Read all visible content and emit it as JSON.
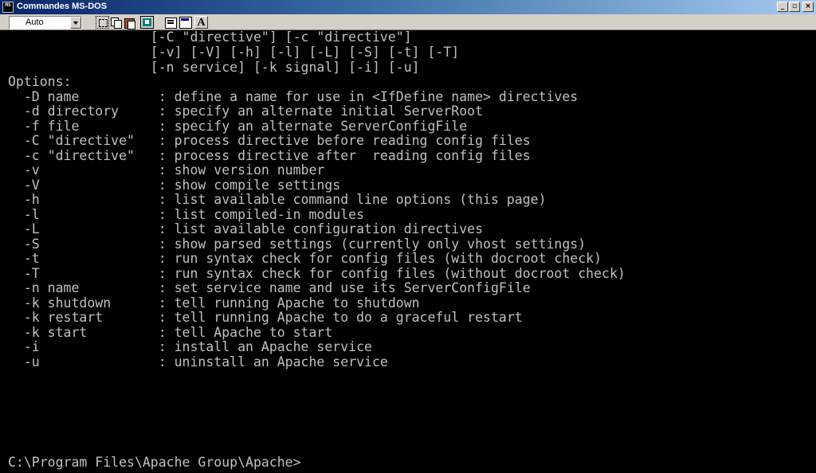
{
  "window": {
    "title": "Commandes MS-DOS",
    "icon_text": "MS"
  },
  "toolbar": {
    "font_size": "Auto",
    "font_button_label": "A"
  },
  "console": {
    "lines": [
      "                  [-C \"directive\"] [-c \"directive\"]",
      "                  [-v] [-V] [-h] [-l] [-L] [-S] [-t] [-T]",
      "                  [-n service] [-k signal] [-i] [-u]",
      "Options:",
      "  -D name          : define a name for use in <IfDefine name> directives",
      "  -d directory     : specify an alternate initial ServerRoot",
      "  -f file          : specify an alternate ServerConfigFile",
      "  -C \"directive\"   : process directive before reading config files",
      "  -c \"directive\"   : process directive after  reading config files",
      "  -v               : show version number",
      "  -V               : show compile settings",
      "  -h               : list available command line options (this page)",
      "  -l               : list compiled-in modules",
      "  -L               : list available configuration directives",
      "  -S               : show parsed settings (currently only vhost settings)",
      "  -t               : run syntax check for config files (with docroot check)",
      "  -T               : run syntax check for config files (without docroot check)",
      "  -n name          : set service name and use its ServerConfigFile",
      "  -k shutdown      : tell running Apache to shutdown",
      "  -k restart       : tell running Apache to do a graceful restart",
      "  -k start         : tell Apache to start",
      "  -i               : install an Apache service",
      "  -u               : uninstall an Apache service",
      "",
      "C:\\Program Files\\Apache Group\\Apache>"
    ]
  }
}
